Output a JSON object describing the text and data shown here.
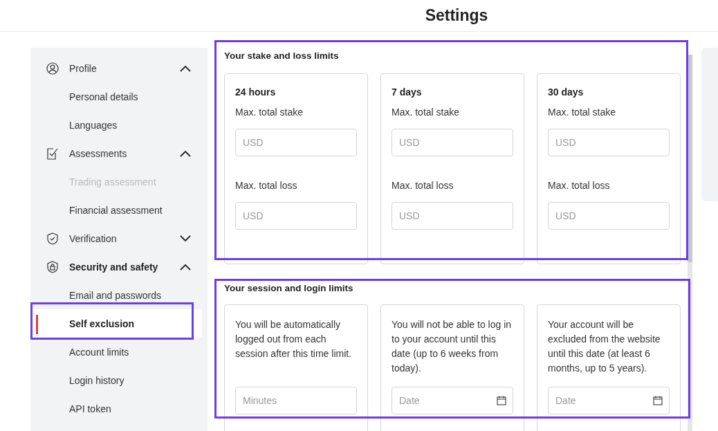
{
  "header": {
    "title": "Settings"
  },
  "sidebar": {
    "items": [
      {
        "label": "Profile",
        "kind": "group",
        "expanded": true,
        "children": [
          {
            "label": "Personal details",
            "disabled": false,
            "selected": false
          },
          {
            "label": "Languages",
            "disabled": false,
            "selected": false
          }
        ]
      },
      {
        "label": "Assessments",
        "kind": "group",
        "expanded": true,
        "children": [
          {
            "label": "Trading assessment",
            "disabled": true,
            "selected": false
          },
          {
            "label": "Financial assessment",
            "disabled": false,
            "selected": false
          }
        ]
      },
      {
        "label": "Verification",
        "kind": "group",
        "expanded": false
      },
      {
        "label": "Security and safety",
        "kind": "group",
        "expanded": true,
        "children": [
          {
            "label": "Email and passwords",
            "disabled": false,
            "selected": false
          },
          {
            "label": "Self exclusion",
            "disabled": false,
            "selected": true
          },
          {
            "label": "Account limits",
            "disabled": false,
            "selected": false
          },
          {
            "label": "Login history",
            "disabled": false,
            "selected": false
          },
          {
            "label": "API token",
            "disabled": false,
            "selected": false
          }
        ]
      }
    ]
  },
  "stake_limits": {
    "title": "Your stake and loss limits",
    "cards": [
      {
        "period": "24 hours",
        "stake_label": "Max. total stake",
        "stake_placeholder": "USD",
        "loss_label": "Max. total loss",
        "loss_placeholder": "USD"
      },
      {
        "period": "7 days",
        "stake_label": "Max. total stake",
        "stake_placeholder": "USD",
        "loss_label": "Max. total loss",
        "loss_placeholder": "USD"
      },
      {
        "period": "30 days",
        "stake_label": "Max. total stake",
        "stake_placeholder": "USD",
        "loss_label": "Max. total loss",
        "loss_placeholder": "USD"
      }
    ]
  },
  "session_limits": {
    "title": "Your session and login limits",
    "cards": [
      {
        "text": "You will be automatically logged out from each session after this time limit.",
        "placeholder": "Minutes",
        "kind": "number"
      },
      {
        "text": "You will not be able to log in to your account until this date (up to 6 weeks from today).",
        "placeholder": "Date",
        "kind": "date"
      },
      {
        "text": "Your account will be excluded from the website until this date (at least 6 months, up to 5 years).",
        "placeholder": "Date",
        "kind": "date"
      }
    ]
  }
}
